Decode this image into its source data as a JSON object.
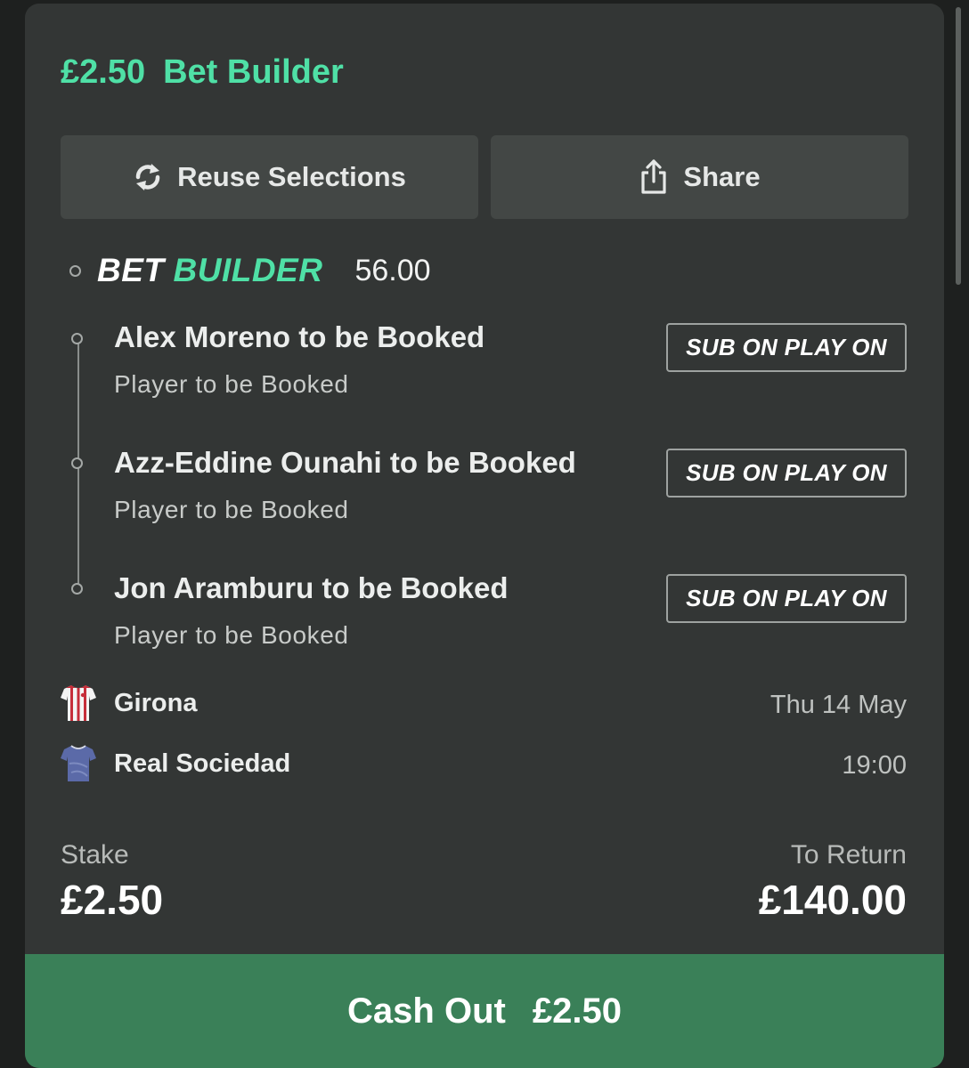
{
  "header": {
    "stake": "£2.50",
    "bet_type": "Bet Builder"
  },
  "actions": {
    "reuse_label": "Reuse Selections",
    "share_label": "Share"
  },
  "bet_builder": {
    "logo_part1": "BET",
    "logo_part2": "BUILDER",
    "odds": "56.00"
  },
  "selections": [
    {
      "title": "Alex Moreno to be Booked",
      "market": "Player to be Booked",
      "badge": "SUB ON PLAY ON"
    },
    {
      "title": "Azz-Eddine Ounahi to be Booked",
      "market": "Player to be Booked",
      "badge": "SUB ON PLAY ON"
    },
    {
      "title": "Jon Aramburu to be Booked",
      "market": "Player to be Booked",
      "badge": "SUB ON PLAY ON"
    }
  ],
  "match": {
    "home": "Girona",
    "away": "Real Sociedad",
    "date": "Thu 14 May",
    "time": "19:00"
  },
  "summary": {
    "stake_label": "Stake",
    "stake_value": "£2.50",
    "return_label": "To Return",
    "return_value": "£140.00"
  },
  "cashout": {
    "label": "Cash Out",
    "value": "£2.50"
  },
  "colors": {
    "accent": "#4fe0a6",
    "cashout_bg": "#3a8058",
    "card_bg": "#333635"
  },
  "icons": {
    "reuse": "refresh-icon",
    "share": "share-icon",
    "home_kit": "shirt-icon",
    "away_kit": "shirt-icon"
  }
}
